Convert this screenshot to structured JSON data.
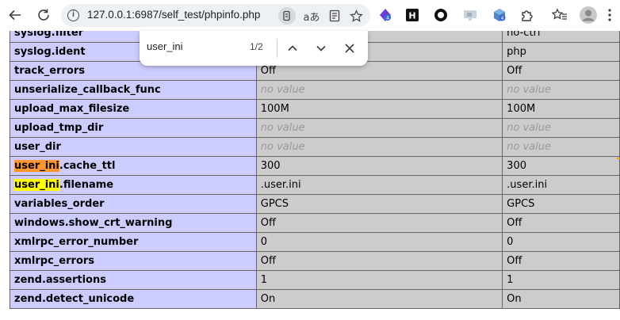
{
  "browser": {
    "url": "127.0.0.1:6987/self_test/phpinfo.php",
    "info_glyph": "i",
    "translate_glyph": "aあ"
  },
  "find": {
    "query": "user_ini",
    "count": "1/2"
  },
  "rows": [
    {
      "name": "syslog.filter",
      "local": "",
      "master": "no-ctrl"
    },
    {
      "name": "syslog.ident",
      "local": "",
      "master": "php"
    },
    {
      "name": "track_errors",
      "local": "Off",
      "master": "Off"
    },
    {
      "name": "unserialize_callback_func",
      "local": "no value",
      "master": "no value"
    },
    {
      "name": "upload_max_filesize",
      "local": "100M",
      "master": "100M"
    },
    {
      "name": "upload_tmp_dir",
      "local": "no value",
      "master": "no value"
    },
    {
      "name": "user_dir",
      "local": "no value",
      "master": "no value"
    },
    {
      "name_hl": "user_ini",
      "name_rest": ".cache_ttl",
      "local": "300",
      "master": "300"
    },
    {
      "name_hl": "user_ini",
      "name_rest": ".filename",
      "local": ".user.ini",
      "master": ".user.ini"
    },
    {
      "name": "variables_order",
      "local": "GPCS",
      "master": "GPCS"
    },
    {
      "name": "windows.show_crt_warning",
      "local": "Off",
      "master": "Off"
    },
    {
      "name": "xmlrpc_error_number",
      "local": "0",
      "master": "0"
    },
    {
      "name": "xmlrpc_errors",
      "local": "Off",
      "master": "Off"
    },
    {
      "name": "zend.assertions",
      "local": "1",
      "master": "1"
    },
    {
      "name": "zend.detect_unicode",
      "local": "On",
      "master": "On"
    }
  ]
}
